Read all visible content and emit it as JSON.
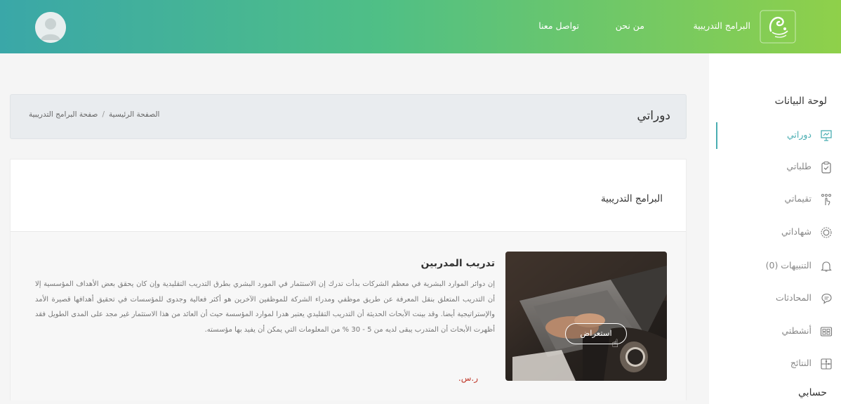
{
  "header": {
    "logo_icon": "brand-logo-icon",
    "nav": [
      {
        "label": "البرامج التدريبية"
      },
      {
        "label": "من نحن"
      },
      {
        "label": "تواصل معنا"
      }
    ],
    "avatar_icon": "user-avatar-icon",
    "colors": {
      "gradient_start": "#3aa7a8",
      "gradient_end": "#8fd04a"
    }
  },
  "sidebar": {
    "heading": "لوحة البيانات",
    "items": [
      {
        "label": "دوراتي",
        "icon": "presentation-icon",
        "active": true
      },
      {
        "label": "طلباتي",
        "icon": "clipboard-check-icon"
      },
      {
        "label": "تقيماتي",
        "icon": "rating-hand-icon"
      },
      {
        "label": "شهاداتي",
        "icon": "certificate-badge-icon"
      },
      {
        "label": "التنبيهات (0)",
        "icon": "bell-icon"
      },
      {
        "label": "المحادثات",
        "icon": "chat-icon"
      },
      {
        "label": "أنشطتي",
        "icon": "activities-icon"
      },
      {
        "label": "النتائج",
        "icon": "results-puzzle-icon"
      }
    ],
    "account_heading": "حسابي",
    "accent": "#4aaeb2"
  },
  "page": {
    "title": "دوراتي",
    "breadcrumb": {
      "home": "الصفحة الرئيسية",
      "separator": "/",
      "current": "صفحة البرامج التدريبية"
    }
  },
  "programs": {
    "section_title": "البرامج التدريبية",
    "courses": [
      {
        "title": "تدريب المدربين",
        "description": "إن دوائر الموارد البشرية في معظم الشركات بدأت تدرك إن الاستثمار في المورد البشري بطرق التدريب التقليدية وإن كان يحقق بعض الأهداف المؤسسية إلا أن التدريب المتعلق بنقل المعرفة عن طريق موظفي ومدراء الشركة للموظفين الآخرين هو أكثر فعالية وجدوى للمؤسسات في تحقيق أهدافها قصيرة الأمد والإستراتيجية أيضا. وقد بينت الأبحاث الحديثة أن التدريب التقليدي يعتبر هدرا لموارد المؤسسة حيث أن العائد من هذا الاستثمار غير مجد على المدى الطويل فقد أظهرت الأبحاث أن المتدرب يبقى لديه من 5 - 30 % من المعلومات التي يمكن أن يفيد بها مؤسسته.",
        "price": "ر.س.",
        "view_button": "استعراض",
        "image": "laptop-hands-photo"
      }
    ]
  }
}
